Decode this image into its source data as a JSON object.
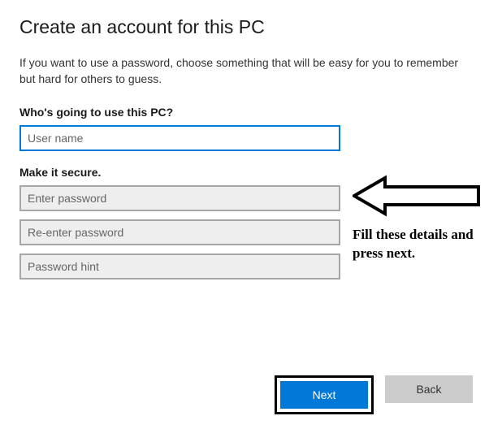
{
  "title": "Create an account for this PC",
  "intro": "If you want to use a password, choose something that will be easy for you to remember but hard for others to guess.",
  "sections": {
    "who": {
      "label": "Who's going to use this PC?",
      "username_placeholder": "User name",
      "username_value": ""
    },
    "secure": {
      "label": "Make it secure.",
      "password_placeholder": "Enter password",
      "password_value": "",
      "password2_placeholder": "Re-enter password",
      "password2_value": "",
      "hint_placeholder": "Password hint",
      "hint_value": ""
    }
  },
  "annotation": {
    "text": "Fill these details and press next."
  },
  "footer": {
    "next_label": "Next",
    "back_label": "Back"
  }
}
